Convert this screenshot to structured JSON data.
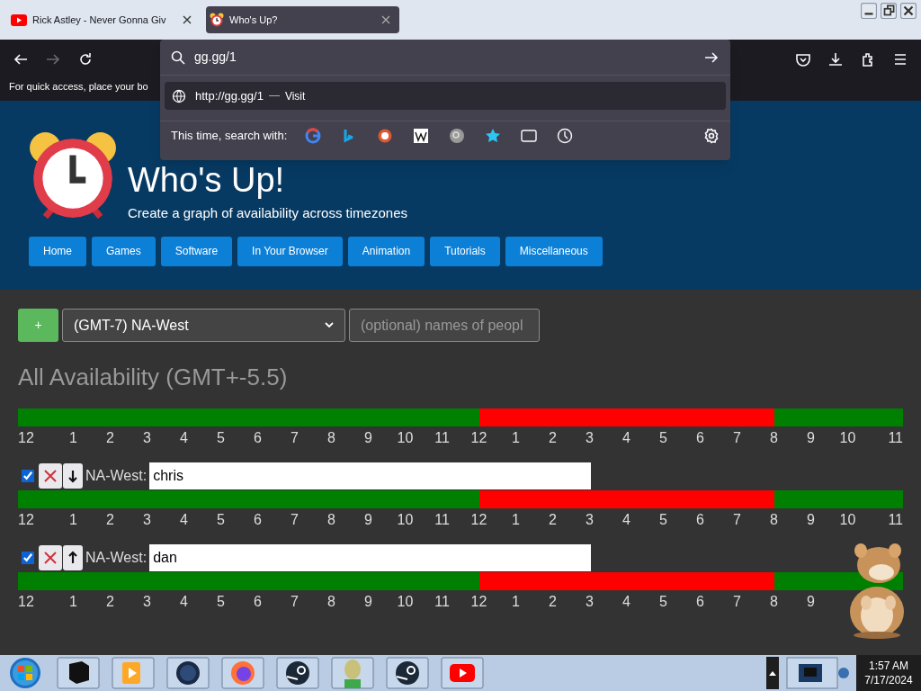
{
  "browser": {
    "tabs": [
      {
        "title": "Rick Astley - Never Gonna Giv",
        "selected": false
      },
      {
        "title": "Who's Up?",
        "selected": true
      }
    ],
    "bookmarks_hint": "For quick access, place your bo",
    "address_bar": {
      "value": "gg.gg/1",
      "suggestion": "http://gg.gg/1",
      "suggestion_action": "Visit",
      "search_with": "This time, search with:"
    }
  },
  "page": {
    "title": "Who's Up!",
    "subtitle": "Create a graph of availability across timezones",
    "nav": [
      "Home",
      "Games",
      "Software",
      "In Your Browser",
      "Animation",
      "Tutorials",
      "Miscellaneous"
    ],
    "add_button": "+",
    "timezone": "(GMT-7) NA-West",
    "names_placeholder": "(optional) names of peopl",
    "heading": "All Availability (GMT+-5.5)",
    "summary": {
      "busy": [
        false,
        false,
        false,
        false,
        false,
        false,
        false,
        false,
        false,
        false,
        false,
        false,
        false,
        false,
        false,
        false,
        false,
        false,
        false,
        false,
        false,
        false,
        false,
        false,
        false,
        true,
        true,
        true,
        true,
        true,
        true,
        true,
        true,
        true,
        true,
        true,
        true,
        true,
        true,
        true,
        true,
        false,
        false,
        false,
        false,
        false,
        false,
        false
      ],
      "hours": [
        "12",
        "1",
        "2",
        "3",
        "4",
        "5",
        "6",
        "7",
        "8",
        "9",
        "10",
        "11",
        "12",
        "1",
        "2",
        "3",
        "4",
        "5",
        "6",
        "7",
        "8",
        "9",
        "10",
        "11"
      ]
    },
    "people": [
      {
        "checked": true,
        "kind": "move_down",
        "zone": "NA-West:",
        "name": "chris",
        "busy": [
          false,
          false,
          false,
          false,
          false,
          false,
          false,
          false,
          false,
          false,
          false,
          false,
          false,
          false,
          false,
          false,
          false,
          false,
          false,
          false,
          false,
          false,
          false,
          false,
          false,
          true,
          true,
          true,
          true,
          true,
          true,
          true,
          true,
          true,
          true,
          true,
          true,
          true,
          true,
          true,
          true,
          false,
          false,
          false,
          false,
          false,
          false,
          false
        ],
        "hours": [
          "12",
          "1",
          "2",
          "3",
          "4",
          "5",
          "6",
          "7",
          "8",
          "9",
          "10",
          "11",
          "12",
          "1",
          "2",
          "3",
          "4",
          "5",
          "6",
          "7",
          "8",
          "9",
          "10",
          "11"
        ]
      },
      {
        "checked": true,
        "kind": "move_up",
        "zone": "NA-West:",
        "name": "dan",
        "busy": [
          false,
          false,
          false,
          false,
          false,
          false,
          false,
          false,
          false,
          false,
          false,
          false,
          false,
          false,
          false,
          false,
          false,
          false,
          false,
          false,
          false,
          false,
          false,
          false,
          false,
          true,
          true,
          true,
          true,
          true,
          true,
          true,
          true,
          true,
          true,
          true,
          true,
          true,
          true,
          true,
          true,
          false,
          false,
          false,
          false,
          false,
          false,
          false
        ],
        "hours": [
          "12",
          "1",
          "2",
          "3",
          "4",
          "5",
          "6",
          "7",
          "8",
          "9",
          "10",
          "11",
          "12",
          "1",
          "2",
          "3",
          "4",
          "5",
          "6",
          "7",
          "8",
          "9"
        ]
      }
    ]
  },
  "taskbar": {
    "time": "1:57 AM",
    "date": "7/17/2024"
  }
}
